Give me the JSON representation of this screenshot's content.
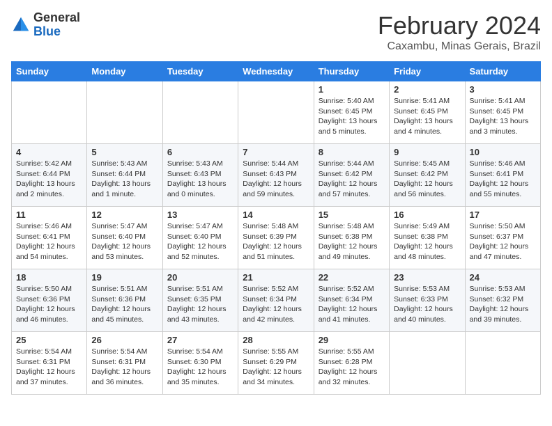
{
  "logo": {
    "general": "General",
    "blue": "Blue"
  },
  "header": {
    "title": "February 2024",
    "subtitle": "Caxambu, Minas Gerais, Brazil"
  },
  "weekdays": [
    "Sunday",
    "Monday",
    "Tuesday",
    "Wednesday",
    "Thursday",
    "Friday",
    "Saturday"
  ],
  "weeks": [
    [
      {
        "day": "",
        "info": ""
      },
      {
        "day": "",
        "info": ""
      },
      {
        "day": "",
        "info": ""
      },
      {
        "day": "",
        "info": ""
      },
      {
        "day": "1",
        "info": "Sunrise: 5:40 AM\nSunset: 6:45 PM\nDaylight: 13 hours\nand 5 minutes."
      },
      {
        "day": "2",
        "info": "Sunrise: 5:41 AM\nSunset: 6:45 PM\nDaylight: 13 hours\nand 4 minutes."
      },
      {
        "day": "3",
        "info": "Sunrise: 5:41 AM\nSunset: 6:45 PM\nDaylight: 13 hours\nand 3 minutes."
      }
    ],
    [
      {
        "day": "4",
        "info": "Sunrise: 5:42 AM\nSunset: 6:44 PM\nDaylight: 13 hours\nand 2 minutes."
      },
      {
        "day": "5",
        "info": "Sunrise: 5:43 AM\nSunset: 6:44 PM\nDaylight: 13 hours\nand 1 minute."
      },
      {
        "day": "6",
        "info": "Sunrise: 5:43 AM\nSunset: 6:43 PM\nDaylight: 13 hours\nand 0 minutes."
      },
      {
        "day": "7",
        "info": "Sunrise: 5:44 AM\nSunset: 6:43 PM\nDaylight: 12 hours\nand 59 minutes."
      },
      {
        "day": "8",
        "info": "Sunrise: 5:44 AM\nSunset: 6:42 PM\nDaylight: 12 hours\nand 57 minutes."
      },
      {
        "day": "9",
        "info": "Sunrise: 5:45 AM\nSunset: 6:42 PM\nDaylight: 12 hours\nand 56 minutes."
      },
      {
        "day": "10",
        "info": "Sunrise: 5:46 AM\nSunset: 6:41 PM\nDaylight: 12 hours\nand 55 minutes."
      }
    ],
    [
      {
        "day": "11",
        "info": "Sunrise: 5:46 AM\nSunset: 6:41 PM\nDaylight: 12 hours\nand 54 minutes."
      },
      {
        "day": "12",
        "info": "Sunrise: 5:47 AM\nSunset: 6:40 PM\nDaylight: 12 hours\nand 53 minutes."
      },
      {
        "day": "13",
        "info": "Sunrise: 5:47 AM\nSunset: 6:40 PM\nDaylight: 12 hours\nand 52 minutes."
      },
      {
        "day": "14",
        "info": "Sunrise: 5:48 AM\nSunset: 6:39 PM\nDaylight: 12 hours\nand 51 minutes."
      },
      {
        "day": "15",
        "info": "Sunrise: 5:48 AM\nSunset: 6:38 PM\nDaylight: 12 hours\nand 49 minutes."
      },
      {
        "day": "16",
        "info": "Sunrise: 5:49 AM\nSunset: 6:38 PM\nDaylight: 12 hours\nand 48 minutes."
      },
      {
        "day": "17",
        "info": "Sunrise: 5:50 AM\nSunset: 6:37 PM\nDaylight: 12 hours\nand 47 minutes."
      }
    ],
    [
      {
        "day": "18",
        "info": "Sunrise: 5:50 AM\nSunset: 6:36 PM\nDaylight: 12 hours\nand 46 minutes."
      },
      {
        "day": "19",
        "info": "Sunrise: 5:51 AM\nSunset: 6:36 PM\nDaylight: 12 hours\nand 45 minutes."
      },
      {
        "day": "20",
        "info": "Sunrise: 5:51 AM\nSunset: 6:35 PM\nDaylight: 12 hours\nand 43 minutes."
      },
      {
        "day": "21",
        "info": "Sunrise: 5:52 AM\nSunset: 6:34 PM\nDaylight: 12 hours\nand 42 minutes."
      },
      {
        "day": "22",
        "info": "Sunrise: 5:52 AM\nSunset: 6:34 PM\nDaylight: 12 hours\nand 41 minutes."
      },
      {
        "day": "23",
        "info": "Sunrise: 5:53 AM\nSunset: 6:33 PM\nDaylight: 12 hours\nand 40 minutes."
      },
      {
        "day": "24",
        "info": "Sunrise: 5:53 AM\nSunset: 6:32 PM\nDaylight: 12 hours\nand 39 minutes."
      }
    ],
    [
      {
        "day": "25",
        "info": "Sunrise: 5:54 AM\nSunset: 6:31 PM\nDaylight: 12 hours\nand 37 minutes."
      },
      {
        "day": "26",
        "info": "Sunrise: 5:54 AM\nSunset: 6:31 PM\nDaylight: 12 hours\nand 36 minutes."
      },
      {
        "day": "27",
        "info": "Sunrise: 5:54 AM\nSunset: 6:30 PM\nDaylight: 12 hours\nand 35 minutes."
      },
      {
        "day": "28",
        "info": "Sunrise: 5:55 AM\nSunset: 6:29 PM\nDaylight: 12 hours\nand 34 minutes."
      },
      {
        "day": "29",
        "info": "Sunrise: 5:55 AM\nSunset: 6:28 PM\nDaylight: 12 hours\nand 32 minutes."
      },
      {
        "day": "",
        "info": ""
      },
      {
        "day": "",
        "info": ""
      }
    ]
  ]
}
